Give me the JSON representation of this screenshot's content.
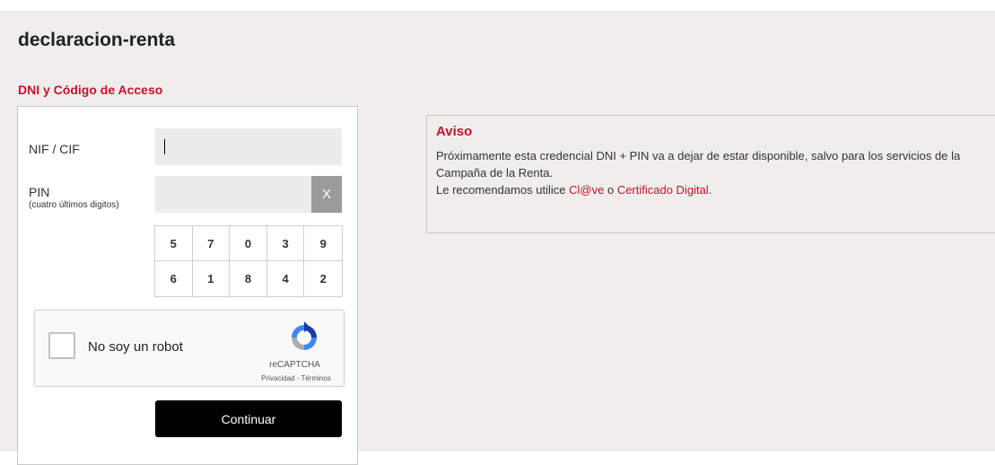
{
  "page": {
    "title": "declaracion-renta"
  },
  "section": {
    "title": "DNI y Código de Acceso"
  },
  "form": {
    "nif_label": "NIF / CIF",
    "nif_value": "",
    "pin_label": "PIN",
    "pin_hint": "(cuatro últimos digitos)",
    "pin_value": "",
    "clear_label": "X",
    "keypad": [
      "5",
      "7",
      "0",
      "3",
      "9",
      "6",
      "1",
      "8",
      "4",
      "2"
    ],
    "submit_label": "Continuar"
  },
  "captcha": {
    "label": "No soy un robot",
    "brand": "reCAPTCHA",
    "privacy_link": "Privacidad",
    "separator": " - ",
    "terms_link": "Términos",
    "logo_icon": "recaptcha-logo"
  },
  "notice": {
    "title": "Aviso",
    "line1": "Próximamente esta credencial DNI + PIN va a dejar de estar disponible, salvo para los servicios de la Campaña de la Renta.",
    "line2_prefix": "Le recomendamos utilice ",
    "link1": "Cl@ve",
    "connector": " o ",
    "link2": "Certificado Digital",
    "suffix": "."
  },
  "colors": {
    "accent": "#c8102e",
    "background": "#efeeed",
    "button": "#000000"
  }
}
